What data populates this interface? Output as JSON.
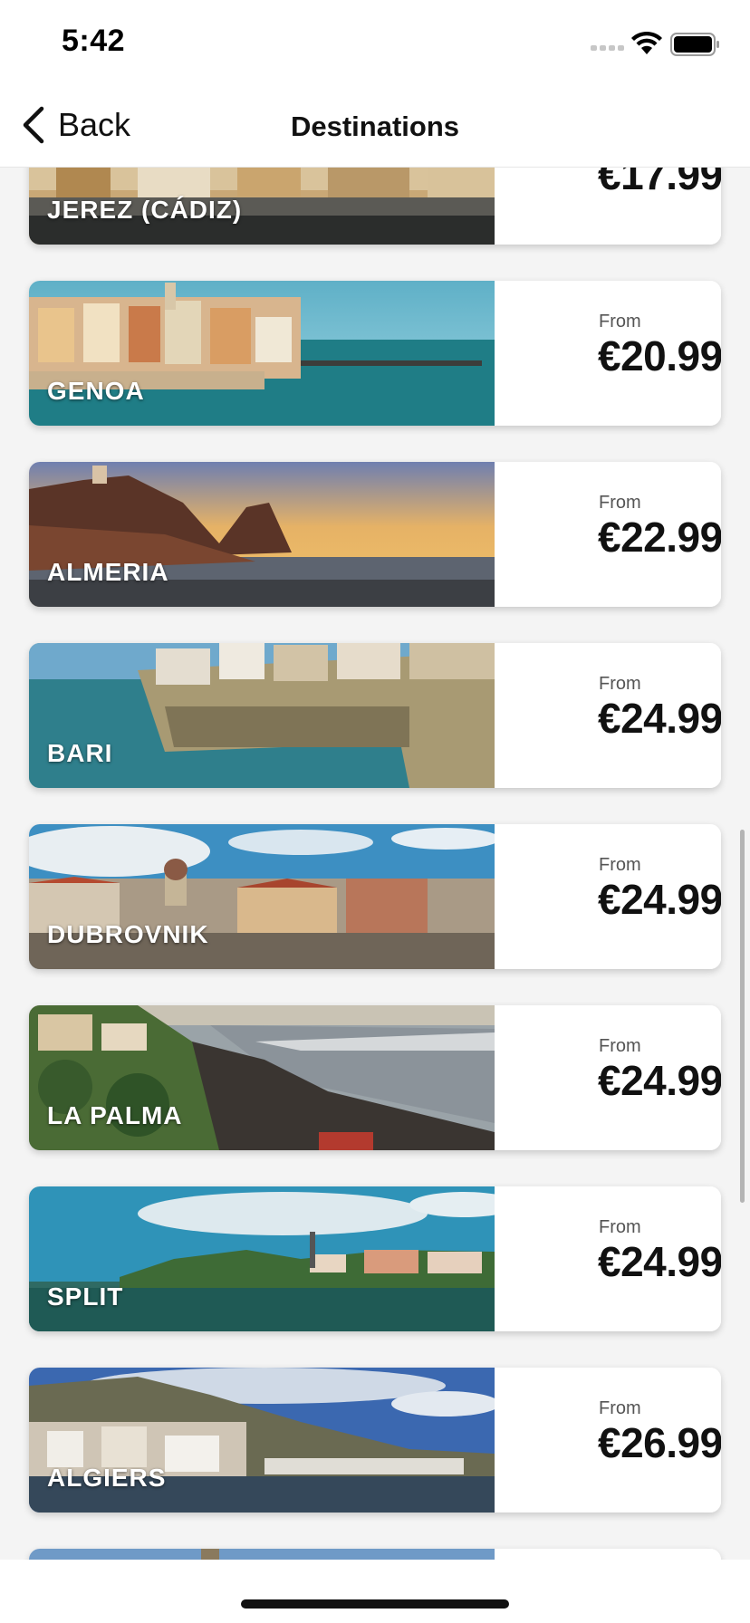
{
  "status_bar": {
    "time": "5:42"
  },
  "nav": {
    "back_label": "Back",
    "title": "Destinations"
  },
  "destinations": [
    {
      "name": "JEREZ (CÁDIZ)",
      "from_label": "",
      "price": "€17.99"
    },
    {
      "name": "GENOA",
      "from_label": "From",
      "price": "€20.99"
    },
    {
      "name": "ALMERIA",
      "from_label": "From",
      "price": "€22.99"
    },
    {
      "name": "BARI",
      "from_label": "From",
      "price": "€24.99"
    },
    {
      "name": "DUBROVNIK",
      "from_label": "From",
      "price": "€24.99"
    },
    {
      "name": "LA PALMA",
      "from_label": "From",
      "price": "€24.99"
    },
    {
      "name": "SPLIT",
      "from_label": "From",
      "price": "€24.99"
    },
    {
      "name": "ALGIERS",
      "from_label": "From",
      "price": "€26.99"
    },
    {
      "name": "",
      "from_label": "",
      "price": ""
    }
  ]
}
